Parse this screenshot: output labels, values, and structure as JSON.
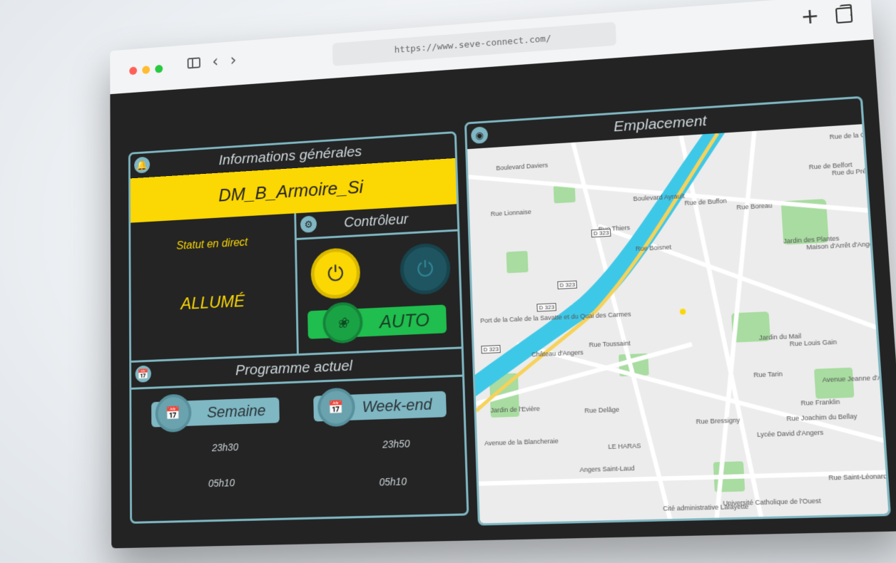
{
  "browser": {
    "url": "https://www.seve-connect.com/",
    "new_tab": "+"
  },
  "info": {
    "title": "Informations générales",
    "device_name": "DM_B_Armoire_Si",
    "status_label": "Statut en direct",
    "status_value": "ALLUMÉ"
  },
  "controller": {
    "title": "Contrôleur",
    "auto_label": "AUTO"
  },
  "program": {
    "title": "Programme actuel",
    "week_label": "Semaine",
    "week_start": "23h30",
    "week_end": "05h10",
    "weekend_label": "Week-end",
    "weekend_start": "23h50",
    "weekend_end": "05h10"
  },
  "location": {
    "title": "Emplacement",
    "labels": [
      "Boulevard Daviers",
      "Boulevard Ayrault",
      "Rue de Buffon",
      "Rue Boreau",
      "Rue Thiers",
      "Rue Boisnet",
      "Jardin des Plantes",
      "Maison d'Arrêt d'Angers",
      "Port de la Cale de la Savatte et du Quai des Carmes",
      "Château d'Angers",
      "Rue Toussaint",
      "Jardin du Mail",
      "Rue Louis Gain",
      "Avenue Jeanne d'Arc",
      "Rue Franklin",
      "Rue Joachim du Bellay",
      "Lycée David d'Angers",
      "LE HARAS",
      "Angers Saint-Laud",
      "Rue Saint-Léonard",
      "Cité administrative Lafayette",
      "Université Catholique de l'Ouest",
      "Rue Bressigny",
      "Jardin de l'Evière",
      "Avenue de la Blancheraie",
      "Rue du Pré-Pigeon",
      "Rue de Belfort",
      "Rue de la Chalouère",
      "Rue Delâge",
      "Rue Lionnaise",
      "Rue Tarin"
    ],
    "road_badges": [
      "D 323",
      "D 323",
      "D 323",
      "D 323"
    ],
    "colors": {
      "river": "#3ec8e8",
      "park": "#a8dca0",
      "road_major": "#f6d25a"
    }
  },
  "colors": {
    "accent": "#7fb7c3",
    "yellow": "#fbd703",
    "green": "#1fbe4e",
    "background": "#232323"
  }
}
